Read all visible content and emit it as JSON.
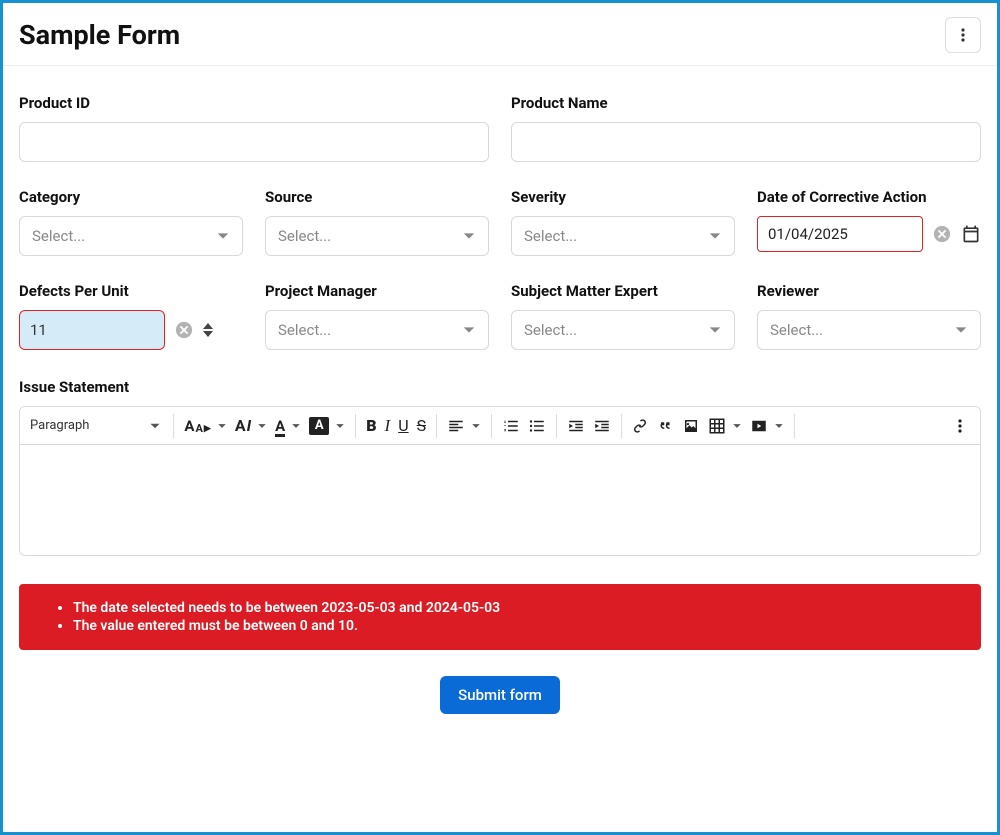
{
  "title": "Sample Form",
  "fields": {
    "product_id": {
      "label": "Product ID",
      "value": ""
    },
    "product_name": {
      "label": "Product Name",
      "value": ""
    },
    "category": {
      "label": "Category",
      "placeholder": "Select..."
    },
    "source": {
      "label": "Source",
      "placeholder": "Select..."
    },
    "severity": {
      "label": "Severity",
      "placeholder": "Select..."
    },
    "date_corrective": {
      "label": "Date of Corrective Action",
      "value": "01/04/2025"
    },
    "defects": {
      "label": "Defects Per Unit",
      "value": "11"
    },
    "pm": {
      "label": "Project Manager",
      "placeholder": "Select..."
    },
    "sme": {
      "label": "Subject Matter Expert",
      "placeholder": "Select..."
    },
    "reviewer": {
      "label": "Reviewer",
      "placeholder": "Select..."
    },
    "issue": {
      "label": "Issue Statement"
    }
  },
  "rte": {
    "block_type": "Paragraph"
  },
  "errors": [
    "The date selected needs to be between 2023-05-03 and 2024-05-03",
    "The value entered must be between 0 and 10."
  ],
  "submit": "Submit form"
}
